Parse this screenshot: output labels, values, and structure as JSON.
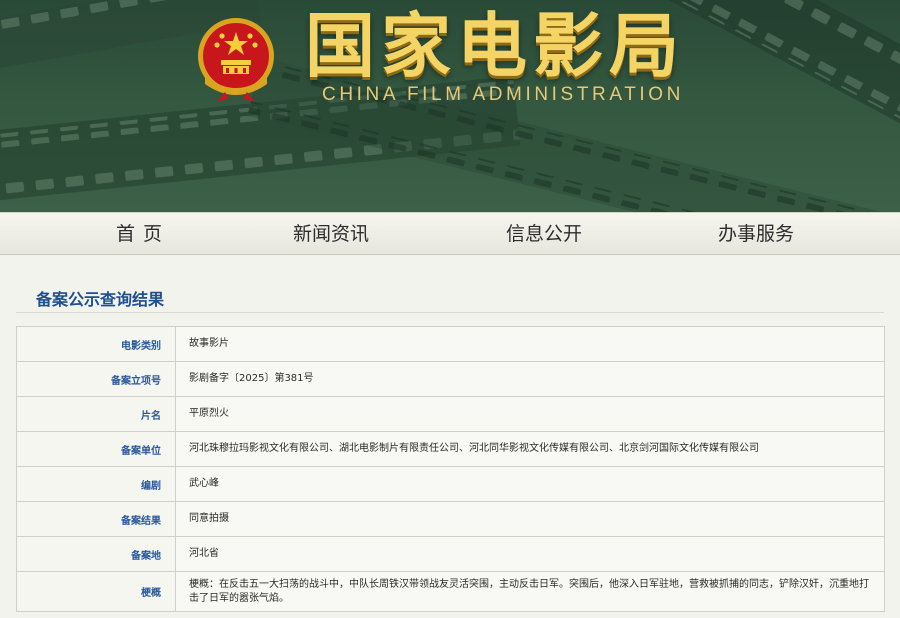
{
  "header": {
    "title": "国家电影局",
    "subtitle": "CHINA FILM ADMINISTRATION"
  },
  "nav": {
    "items": [
      {
        "label": "首页"
      },
      {
        "label": "新闻资讯"
      },
      {
        "label": "信息公开"
      },
      {
        "label": "办事服务"
      }
    ]
  },
  "section": {
    "title": "备案公示查询结果"
  },
  "record": {
    "rows": [
      {
        "label": "电影类别",
        "value": "故事影片"
      },
      {
        "label": "备案立项号",
        "value": "影剧备字〔2025〕第381号"
      },
      {
        "label": "片名",
        "value": "平原烈火"
      },
      {
        "label": "备案单位",
        "value": "河北珠穆拉玛影视文化有限公司、湖北电影制片有限责任公司、河北同华影视文化传媒有限公司、北京剑河国际文化传媒有限公司"
      },
      {
        "label": "编剧",
        "value": "武心峰"
      },
      {
        "label": "备案结果",
        "value": "同意拍摄"
      },
      {
        "label": "备案地",
        "value": "河北省"
      },
      {
        "label": "梗概",
        "value": "梗概：在反击五一大扫荡的战斗中，中队长周铁汉带领战友灵活突围，主动反击日军。突围后，他深入日军驻地，营救被抓捕的同志，铲除汉奸，沉重地打击了日军的嚣张气焰。"
      }
    ]
  },
  "colors": {
    "banner_green": "#33573f",
    "title_gold": "#f3d465",
    "link_blue": "#1f4f8f",
    "label_blue": "#2b5a9a",
    "emblem_red": "#c8161d"
  },
  "icons": {
    "emblem": "national-emblem-icon"
  }
}
